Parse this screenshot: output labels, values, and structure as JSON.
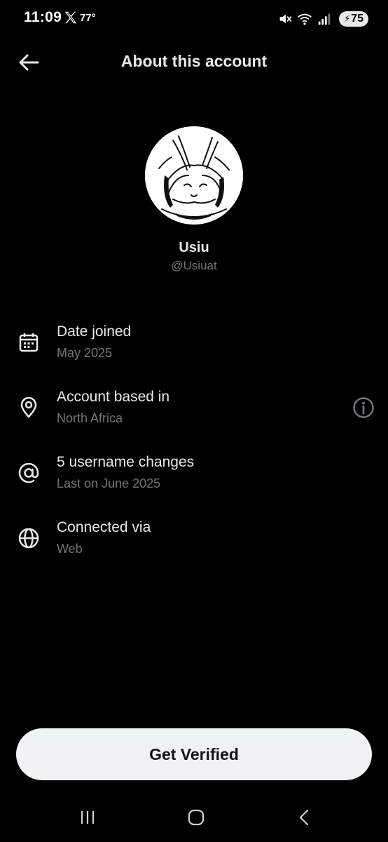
{
  "status_bar": {
    "time": "11:09",
    "temperature": "77°",
    "battery": "75",
    "icons": [
      "x-logo-icon",
      "mute-icon",
      "wifi-icon",
      "signal-icon",
      "battery-icon"
    ]
  },
  "header": {
    "title": "About this account",
    "back_icon": "arrow-left-icon"
  },
  "profile": {
    "name": "Usiu",
    "handle": "@Usiuat",
    "avatar_icon": "sketch-avatar"
  },
  "info_items": [
    {
      "icon": "calendar-icon",
      "title": "Date joined",
      "subtitle": "May 2025"
    },
    {
      "icon": "location-pin-icon",
      "title": "Account based in",
      "subtitle": "North Africa"
    },
    {
      "icon": "at-sign-icon",
      "title": "5 username changes",
      "subtitle": "Last on June 2025"
    },
    {
      "icon": "globe-icon",
      "title": "Connected via",
      "subtitle": "Web"
    }
  ],
  "cta": {
    "label": "Get Verified"
  },
  "nav": {
    "icons": [
      "recent-apps-icon",
      "home-icon",
      "back-icon"
    ]
  },
  "colors": {
    "background": "#000000",
    "text_primary": "#e7e9ea",
    "text_secondary": "#71767b",
    "button_bg": "#eff3f4",
    "button_text": "#0f1419"
  }
}
